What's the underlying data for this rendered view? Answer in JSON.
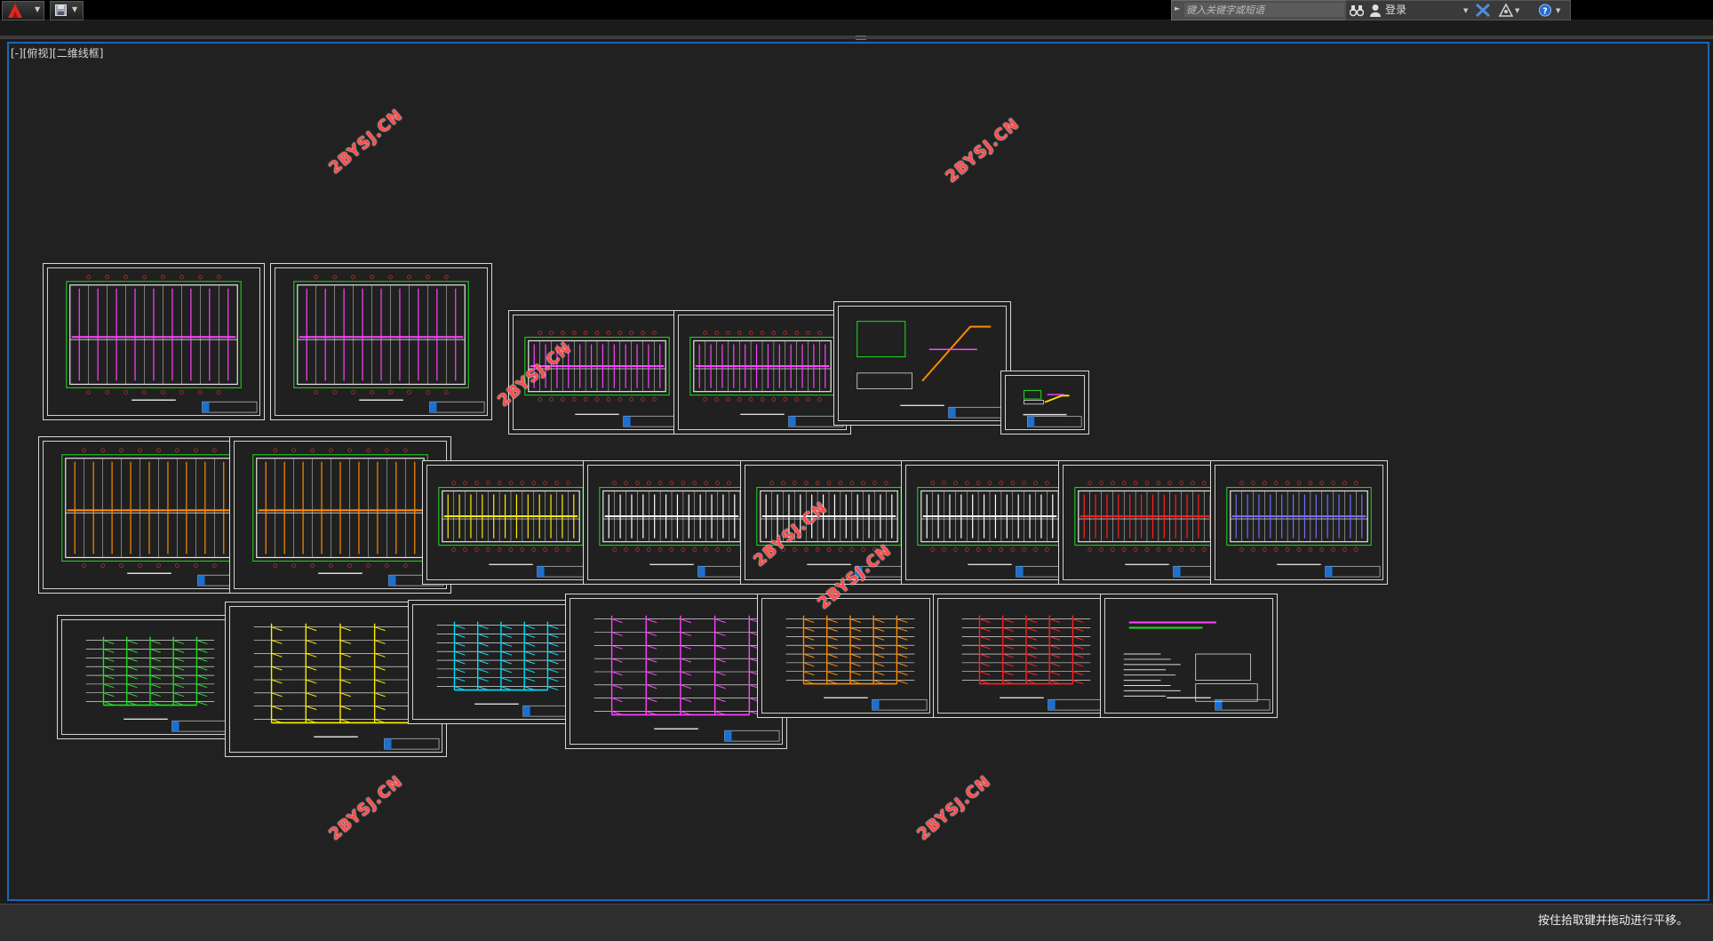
{
  "titlebar": {
    "search": {
      "placeholder": "键入关键字或短语"
    },
    "login_label": "登录",
    "icons": [
      "autocad-logo-icon",
      "save-icon",
      "binoculars-icon",
      "user-icon",
      "exchange-icon",
      "a360-icon",
      "help-icon"
    ]
  },
  "viewport": {
    "label": "[-][俯视][二维线框]"
  },
  "watermarks": [
    "2BYSJ.CN",
    "2BYSJ.CN",
    "2BYSJ.CN",
    "2BYSJ.CN",
    "2BYSJ.CN",
    "2BYSJ.CN",
    "2BYSJ.CN"
  ],
  "sheets": [
    {
      "kind": "plan",
      "accent": "#ff44ff",
      "wire": "#22dd22"
    },
    {
      "kind": "plan",
      "accent": "#ff44ff",
      "wire": "#22dd22"
    },
    {
      "kind": "strip",
      "accent": "#ff44ff",
      "wire": "#22dd22"
    },
    {
      "kind": "strip",
      "accent": "#ff44ff",
      "wire": "#22dd22"
    },
    {
      "kind": "detail",
      "accent": "#ff8c00",
      "wire": "#22dd22"
    },
    {
      "kind": "detail",
      "accent": "#ffdd00",
      "wire": "#22dd22"
    },
    {
      "kind": "plan",
      "accent": "#ff8c00",
      "wire": "#22dd22"
    },
    {
      "kind": "plan",
      "accent": "#ff8c00",
      "wire": "#22dd22"
    },
    {
      "kind": "strip",
      "accent": "#ffee00",
      "wire": "#22dd22"
    },
    {
      "kind": "strip",
      "accent": "#ffffff",
      "wire": "#22dd22"
    },
    {
      "kind": "strip",
      "accent": "#ffffff",
      "wire": "#22dd22"
    },
    {
      "kind": "strip",
      "accent": "#ffffff",
      "wire": "#22dd22"
    },
    {
      "kind": "strip",
      "accent": "#ff2020",
      "wire": "#22dd22"
    },
    {
      "kind": "strip",
      "accent": "#7070ff",
      "wire": "#22dd22"
    },
    {
      "kind": "riser",
      "accent": "#22dd22",
      "wire": "#ffffff"
    },
    {
      "kind": "riser",
      "accent": "#ffee00",
      "wire": "#ffffff"
    },
    {
      "kind": "riser",
      "accent": "#00e0ff",
      "wire": "#ffffff"
    },
    {
      "kind": "riser",
      "accent": "#ff44ff",
      "wire": "#ffffff"
    },
    {
      "kind": "riser",
      "accent": "#ff8c00",
      "wire": "#ffffff"
    },
    {
      "kind": "riser",
      "accent": "#ff2020",
      "wire": "#ffffff"
    },
    {
      "kind": "notes",
      "accent": "#ffffff",
      "wire": "#22dd22"
    }
  ],
  "status": {
    "message": "按住拾取键并拖动进行平移。"
  }
}
